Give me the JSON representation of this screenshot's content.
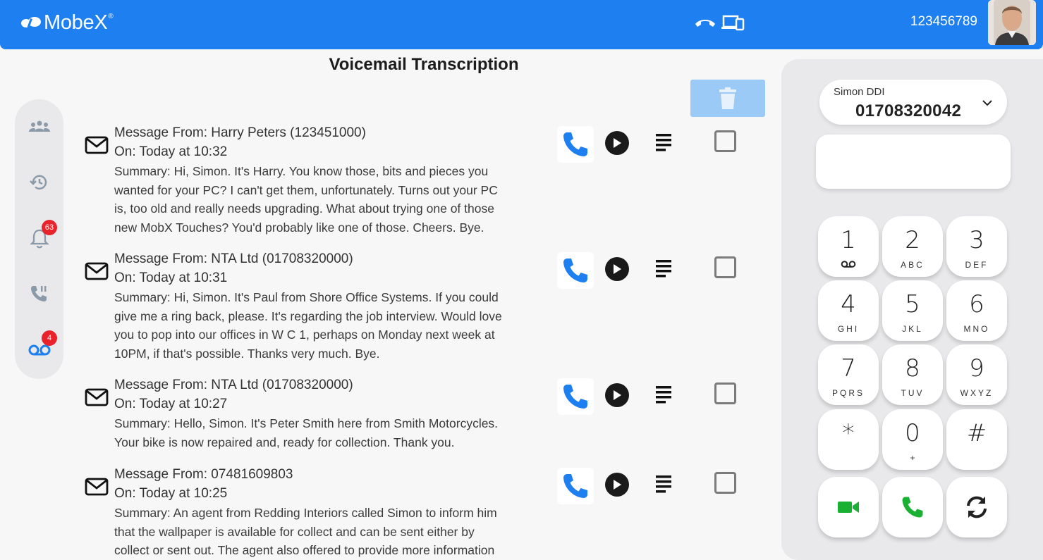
{
  "header": {
    "brand": "MobeX",
    "brand_mark": "®",
    "account_number": "123456789",
    "icons": [
      "hangup-icon",
      "devices-icon"
    ],
    "color": "#1e7ff0"
  },
  "sidebar": {
    "items": [
      {
        "icon": "contacts-icon"
      },
      {
        "icon": "history-icon"
      },
      {
        "icon": "notifications-bell-icon",
        "badge": "63"
      },
      {
        "icon": "call-hold-icon"
      },
      {
        "icon": "voicemail-icon",
        "badge": "4"
      }
    ]
  },
  "page": {
    "title": "Voicemail Transcription"
  },
  "messages": [
    {
      "from": "Message From: Harry Peters (123451000)",
      "on": "On: Today at 10:32",
      "summary_lines": [
        "Summary: Hi, Simon. It's Harry. You know those, bits and pieces you",
        "wanted for your PC? I can't get them, unfortunately. Turns out your PC",
        "is, too old and really needs upgrading. What about trying one of those",
        "new MobX Touches? You'd probably like one of those. Cheers. Bye."
      ]
    },
    {
      "from": "Message From: NTA Ltd (01708320000)",
      "on": "On: Today at 10:31",
      "summary_lines": [
        "Summary: Hi, Simon. It's Paul from Shore Office Systems. If you could",
        "give me a ring back, please. It's regarding the job interview. Would love",
        "you to pop into our offices in W C 1, perhaps on Monday next week at",
        "10PM, if that's possible. Thanks very much. Bye."
      ]
    },
    {
      "from": "Message From: NTA Ltd (01708320000)",
      "on": "On: Today at 10:27",
      "summary_lines": [
        "Summary: Hello, Simon. It's Peter Smith here from Smith Motorcycles.",
        "Your bike is now repaired and, ready for collection. Thank you."
      ]
    },
    {
      "from": "Message From: 07481609803",
      "on": "On: Today at 10:25",
      "summary_lines": [
        "Summary: An agent from Redding Interiors called Simon to inform him",
        "that the wallpaper is available for collect and can be sent either by",
        "collect or sent out. The agent also offered to provide more information"
      ]
    }
  ],
  "dialer": {
    "ddi_label": "Simon DDI",
    "ddi_number": "01708320042",
    "display_value": "",
    "keys": [
      {
        "digit": "1",
        "sub": ""
      },
      {
        "digit": "2",
        "sub": "ABC"
      },
      {
        "digit": "3",
        "sub": "DEF"
      },
      {
        "digit": "4",
        "sub": "GHI"
      },
      {
        "digit": "5",
        "sub": "JKL"
      },
      {
        "digit": "6",
        "sub": "MNO"
      },
      {
        "digit": "7",
        "sub": "PQRS"
      },
      {
        "digit": "8",
        "sub": "TUV"
      },
      {
        "digit": "9",
        "sub": "WXYZ"
      },
      {
        "digit": "*",
        "sub": ""
      },
      {
        "digit": "0",
        "sub": "+"
      },
      {
        "digit": "#",
        "sub": ""
      }
    ],
    "action_icons": [
      "video-call-icon",
      "voice-call-icon",
      "refresh-icon"
    ],
    "call_color": "#1ab033"
  }
}
